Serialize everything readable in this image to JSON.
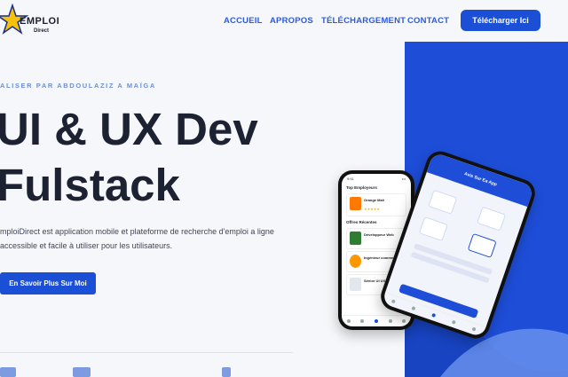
{
  "logo": {
    "text": "EMPLOI",
    "sub": "Direct"
  },
  "nav": {
    "items": [
      "ACCUEIL",
      "APROPOS",
      "TÉLÉCHARGEMENT",
      "CONTACT"
    ],
    "download_label": "Télécharger Ici"
  },
  "hero": {
    "subtitle": "ALISER PAR ABDOULAZIZ A MAÏGA",
    "title_line1": "UI & UX Dev",
    "title_line2": "Fulstack",
    "description": "mploiDirect est application mobile et plateforme de recherche d'emploi a ligne accessible et facile à utiliser pour les utilisateurs.",
    "cta_label": "En Savoir Plus Sur Moi"
  },
  "phone_left": {
    "top_section": "Top Employeurs",
    "employer": "Orange Mali",
    "recent_section": "Offres Récentes",
    "offers": [
      "Développeur Web",
      "Ingénieur commercial",
      "Sênior UI UX Designer"
    ]
  },
  "phone_right": {
    "header": "Avis Sur Ea App"
  },
  "colors": {
    "accent": "#1a4fd6",
    "panel": "#1e4ed8",
    "text": "#1c2231"
  }
}
